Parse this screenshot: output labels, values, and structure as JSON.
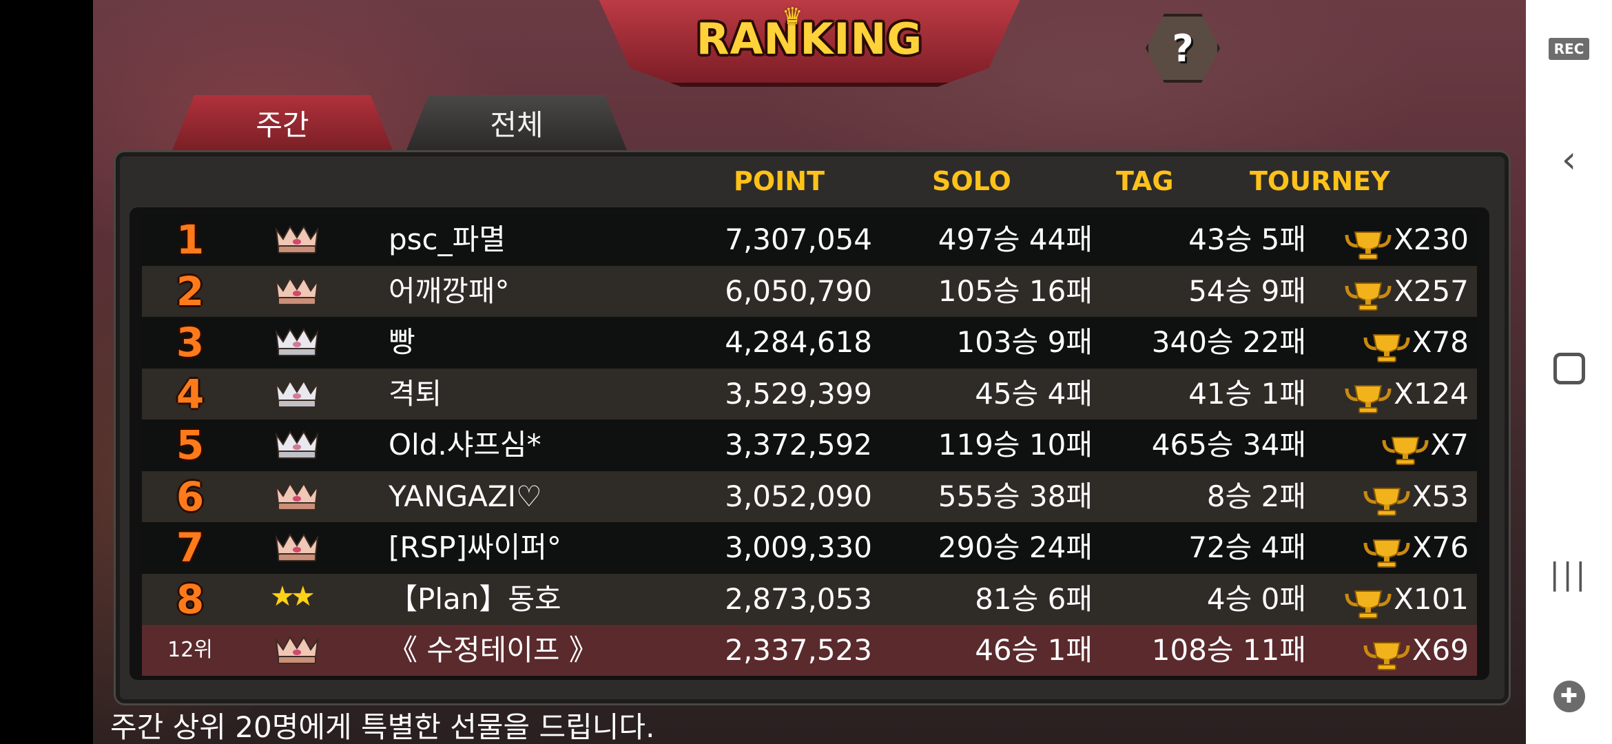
{
  "title": "RANKING",
  "tabs": [
    {
      "label": "주간",
      "active": true
    },
    {
      "label": "전체",
      "active": false
    }
  ],
  "columns": {
    "point": "POINT",
    "solo": "SOLO",
    "tag": "TAG",
    "tourney": "TOURNEY"
  },
  "rows": [
    {
      "rank": "1",
      "badge": "bronze-crown",
      "nickname": "psc_파멸",
      "point": "7,307,054",
      "solo": "497승 44패",
      "tag": "43승 5패",
      "tourney": "X230"
    },
    {
      "rank": "2",
      "badge": "bronze-crown",
      "nickname": "어깨깡패°",
      "point": "6,050,790",
      "solo": "105승 16패",
      "tag": "54승 9패",
      "tourney": "X257"
    },
    {
      "rank": "3",
      "badge": "silver-crown",
      "nickname": "빵",
      "point": "4,284,618",
      "solo": "103승 9패",
      "tag": "340승 22패",
      "tourney": "X78"
    },
    {
      "rank": "4",
      "badge": "silver-crown",
      "nickname": "격퇴",
      "point": "3,529,399",
      "solo": "45승 4패",
      "tag": "41승 1패",
      "tourney": "X124"
    },
    {
      "rank": "5",
      "badge": "silver-crown",
      "nickname": "Old.샤프심*",
      "point": "3,372,592",
      "solo": "119승 10패",
      "tag": "465승 34패",
      "tourney": "X7"
    },
    {
      "rank": "6",
      "badge": "bronze-crown",
      "nickname": "YANGAZI♡",
      "point": "3,052,090",
      "solo": "555승 38패",
      "tag": "8승 2패",
      "tourney": "X53"
    },
    {
      "rank": "7",
      "badge": "bronze-crown",
      "nickname": "[RSP]싸이퍼°",
      "point": "3,009,330",
      "solo": "290승 24패",
      "tag": "72승 4패",
      "tourney": "X76"
    },
    {
      "rank": "8",
      "badge": "two-stars",
      "nickname": "【Plan】동호",
      "point": "2,873,053",
      "solo": "81승 6패",
      "tag": "4승 0패",
      "tourney": "X101"
    },
    {
      "rank": "12위",
      "badge": "bronze-crown",
      "nickname": "《 수정테이프 》",
      "point": "2,337,523",
      "solo": "46승 1패",
      "tag": "108승 11패",
      "tourney": "X69",
      "is_me": true
    }
  ],
  "footer_note": "주간 상위 20명에게 특별한 선물을 드립니다.",
  "system": {
    "rec_label": "REC"
  },
  "colors": {
    "accent_gold": "#ffc21a",
    "rank_orange": "#ff7a1a",
    "tab_red": "#b0313b",
    "close_red": "#d0262c"
  }
}
